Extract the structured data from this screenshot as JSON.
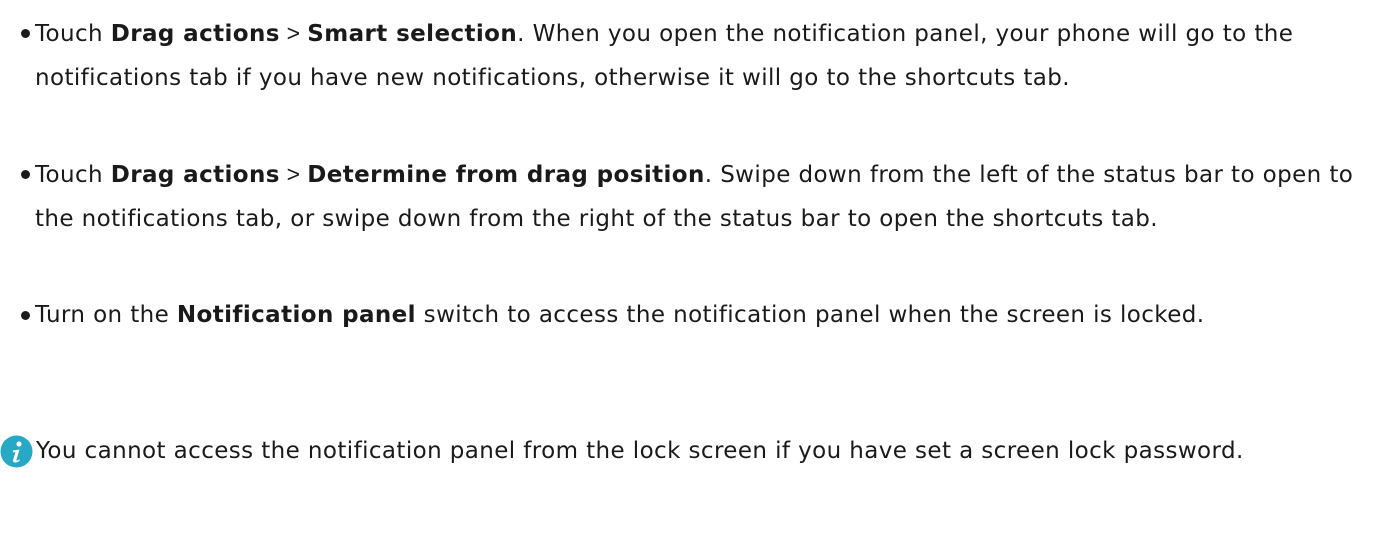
{
  "items": [
    {
      "prefix": "Touch ",
      "bold1": "Drag actions",
      "sep": " > ",
      "bold2": "Smart selection",
      "rest": ". When you open the notification panel, your phone will go to the notifications tab if you have new notifications, otherwise it will go to the shortcuts tab."
    },
    {
      "prefix": "Touch ",
      "bold1": "Drag actions",
      "sep": " > ",
      "bold2": "Determine from drag position",
      "rest": ". Swipe down from the left of the status bar to open to the notifications tab, or swipe down from the right of the status bar to open the shortcuts tab."
    },
    {
      "prefix": "Turn on the ",
      "bold1": "Notification panel",
      "rest": " switch to access the notification panel when the screen is locked."
    }
  ],
  "note": {
    "icon": "info-icon",
    "icon_color": "#27a8c4",
    "text": "You cannot access the notification panel from the lock screen if you have set a screen lock password."
  }
}
